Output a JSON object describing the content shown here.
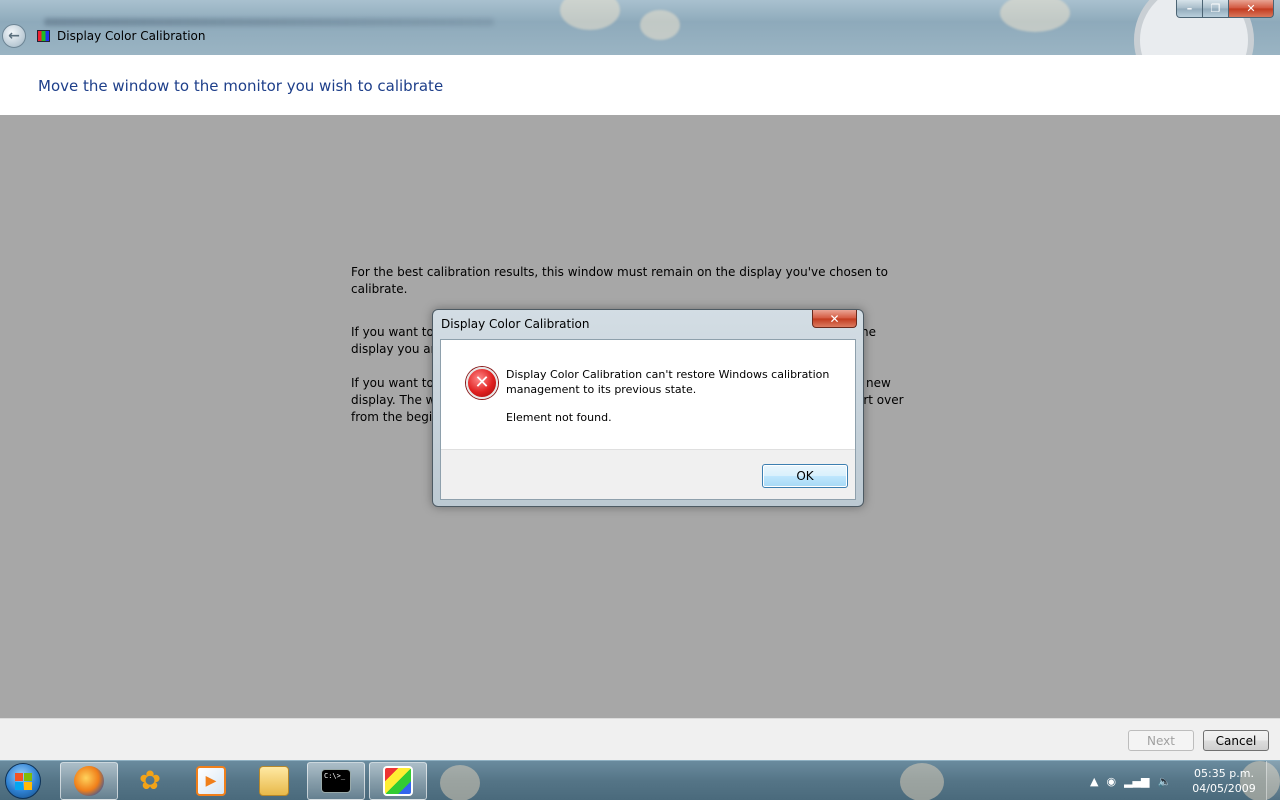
{
  "window": {
    "title": "Display Color Calibration"
  },
  "header": {
    "heading": "Move the window to the monitor you wish to calibrate"
  },
  "content": {
    "paragraph1": "For the best calibration results, this window must remain on the display you've chosen to calibrate.",
    "paragraph2_start": "If you want to",
    "paragraph2_line2_start": "display you ar",
    "paragraph2_end": "he",
    "paragraph3_start": "If you want to",
    "paragraph3_line2_start": "display. The w",
    "paragraph3_line3_start": "from the begi",
    "paragraph3_end1": "new",
    "paragraph3_end2": "art over"
  },
  "dialog": {
    "title": "Display Color Calibration",
    "close_glyph": "✕",
    "icon": "error-icon",
    "message": "Display Color Calibration can't restore Windows calibration management to its previous state.",
    "detail": "Element not found.",
    "ok_label": "OK"
  },
  "commands": {
    "next_label": "Next",
    "cancel_label": "Cancel"
  },
  "taskbar": {
    "items": [
      "firefox-icon",
      "messenger-icon",
      "media-player-icon",
      "explorer-folder-icon",
      "command-prompt-icon",
      "display-calibration-icon"
    ],
    "cmd_text": "C:\\>_",
    "tray_up": "▲",
    "time": "05:35 p.m.",
    "date": "04/05/2009"
  },
  "colors": {
    "heading": "#1e3f8a",
    "main_bg": "#a7a7a7",
    "close_red": "#c13a1e",
    "ok_border": "#3c7fb1"
  }
}
